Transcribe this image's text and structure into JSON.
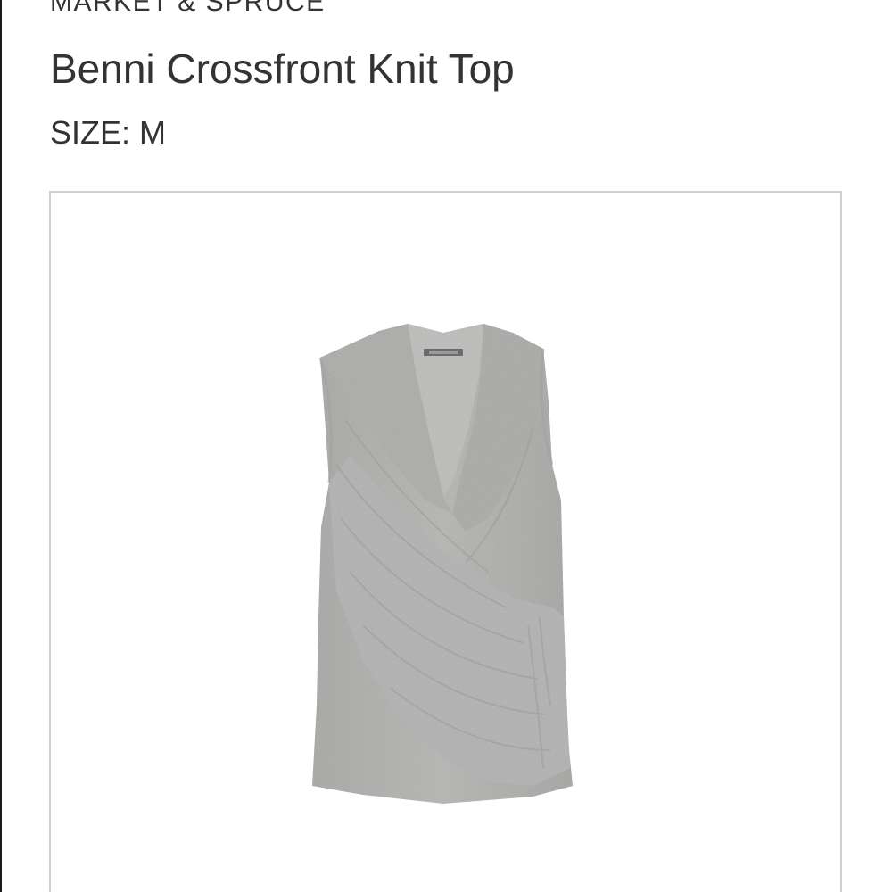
{
  "product": {
    "brand": "MARKET & SPRUCE",
    "name": "Benni Crossfront Knit Top",
    "size_label": "SIZE:",
    "size_value": "M"
  },
  "image": {
    "description_icon": "sleeveless-gray-wrap-top-image",
    "garment_color": "#b6b6b4"
  },
  "colors": {
    "text": "#333333",
    "frame_border": "#cfcfcf",
    "background": "#ffffff"
  }
}
